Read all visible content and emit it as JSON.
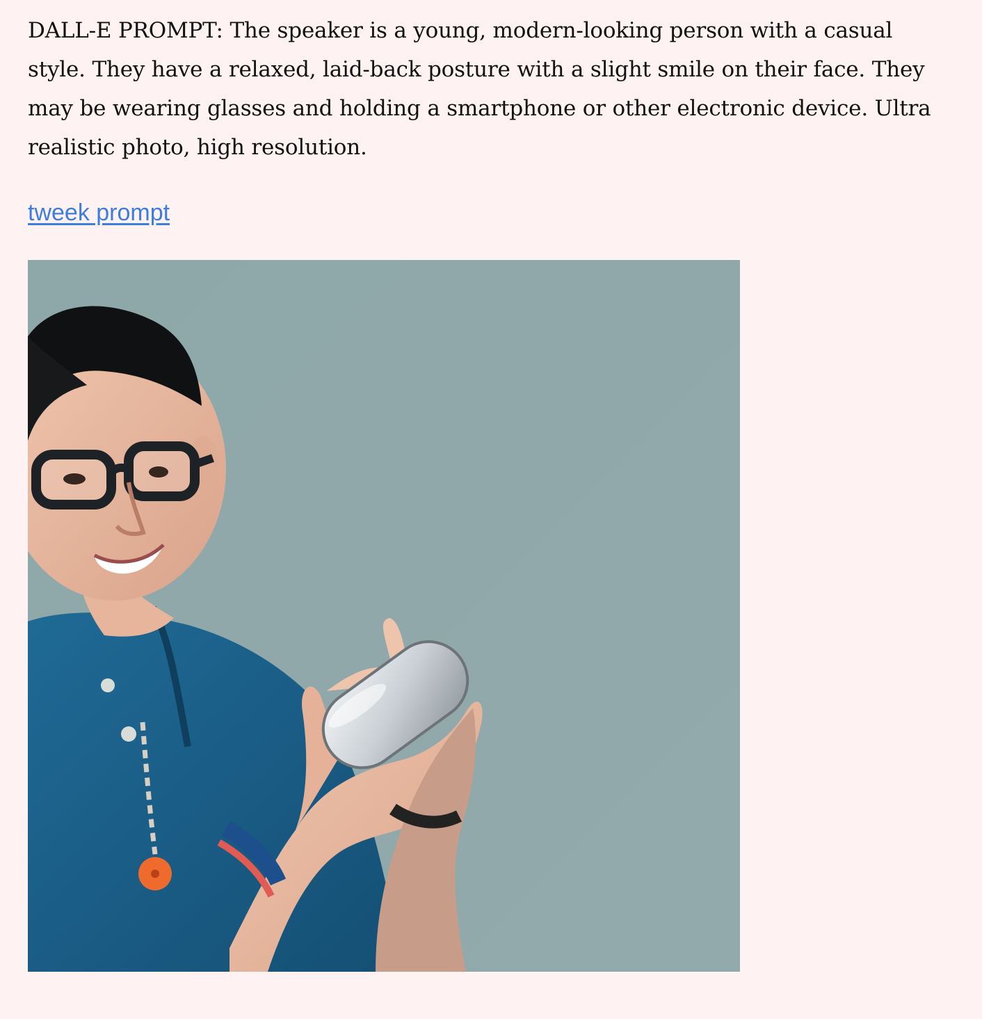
{
  "prompt": {
    "text": "DALL-E PROMPT: The speaker is a young, modern-looking person with a casual style. They have a relaxed, laid-back posture with a slight smile on their face. They may be wearing glasses and holding a smartphone or other electronic device. Ultra realistic photo, high resolution."
  },
  "link": {
    "label": "tweek prompt"
  },
  "colors": {
    "page_background": "#fff2f2",
    "link": "#3b7de0",
    "image_background": "#8fa8aa"
  }
}
